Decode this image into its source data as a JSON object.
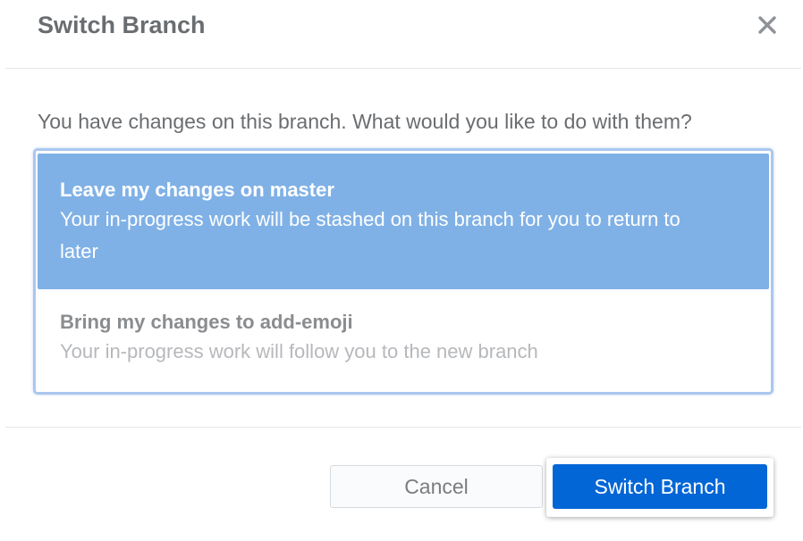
{
  "dialog": {
    "title": "Switch Branch",
    "close_icon": "close-icon",
    "prompt": "You have changes on this branch. What would you like to do with them?",
    "options": [
      {
        "title": "Leave my changes on master",
        "description": "Your in-progress work will be stashed on this branch for you to return to later",
        "selected": true
      },
      {
        "title": "Bring my changes to add-emoji",
        "description": "Your in-progress work will follow you to the new branch",
        "selected": false
      }
    ],
    "buttons": {
      "cancel_label": "Cancel",
      "submit_label": "Switch Branch"
    }
  },
  "colors": {
    "selected_option_bg": "#80b1e6",
    "primary_button_bg": "#0366d6",
    "title_text": "#6a6d70"
  }
}
